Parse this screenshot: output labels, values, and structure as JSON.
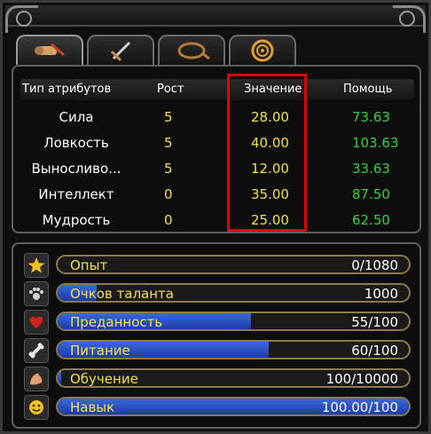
{
  "header": {
    "col_type": "Тип атрибутов",
    "col_growth": "Рост",
    "col_value": "Значение",
    "col_help": "Помощь"
  },
  "attributes": [
    {
      "name": "Сила",
      "growth": "5",
      "value": "28.00",
      "help": "73.63"
    },
    {
      "name": "Ловкость",
      "growth": "5",
      "value": "40.00",
      "help": "103.63"
    },
    {
      "name": "Выносливо...",
      "growth": "5",
      "value": "12.00",
      "help": "33.63"
    },
    {
      "name": "Интеллект",
      "growth": "0",
      "value": "35.00",
      "help": "87.50"
    },
    {
      "name": "Мудрость",
      "growth": "0",
      "value": "25.00",
      "help": "62.50"
    }
  ],
  "stats": [
    {
      "label": "Опыт",
      "value": "0/1080",
      "fill": 0,
      "icon": "star-icon"
    },
    {
      "label": "Очков таланта",
      "value": "1000",
      "fill": 0.11,
      "icon": "paw-icon"
    },
    {
      "label": "Преданность",
      "value": "55/100",
      "fill": 0.55,
      "icon": "heart-icon"
    },
    {
      "label": "Питание",
      "value": "60/100",
      "fill": 0.6,
      "icon": "bone-icon"
    },
    {
      "label": "Обучение",
      "value": "100/10000",
      "fill": 0.01,
      "icon": "muscle-icon"
    },
    {
      "label": "Навык",
      "value": "100.00/100",
      "fill": 1.0,
      "icon": "smiley-icon"
    }
  ],
  "tabs": [
    {
      "icon": "scroll-icon"
    },
    {
      "icon": "sword-icon"
    },
    {
      "icon": "whip-icon"
    },
    {
      "icon": "spiral-icon"
    }
  ],
  "colors": {
    "highlight": "#e00000",
    "value": "#f5e04a",
    "help": "#39d039",
    "bar": "#2a50c8"
  }
}
